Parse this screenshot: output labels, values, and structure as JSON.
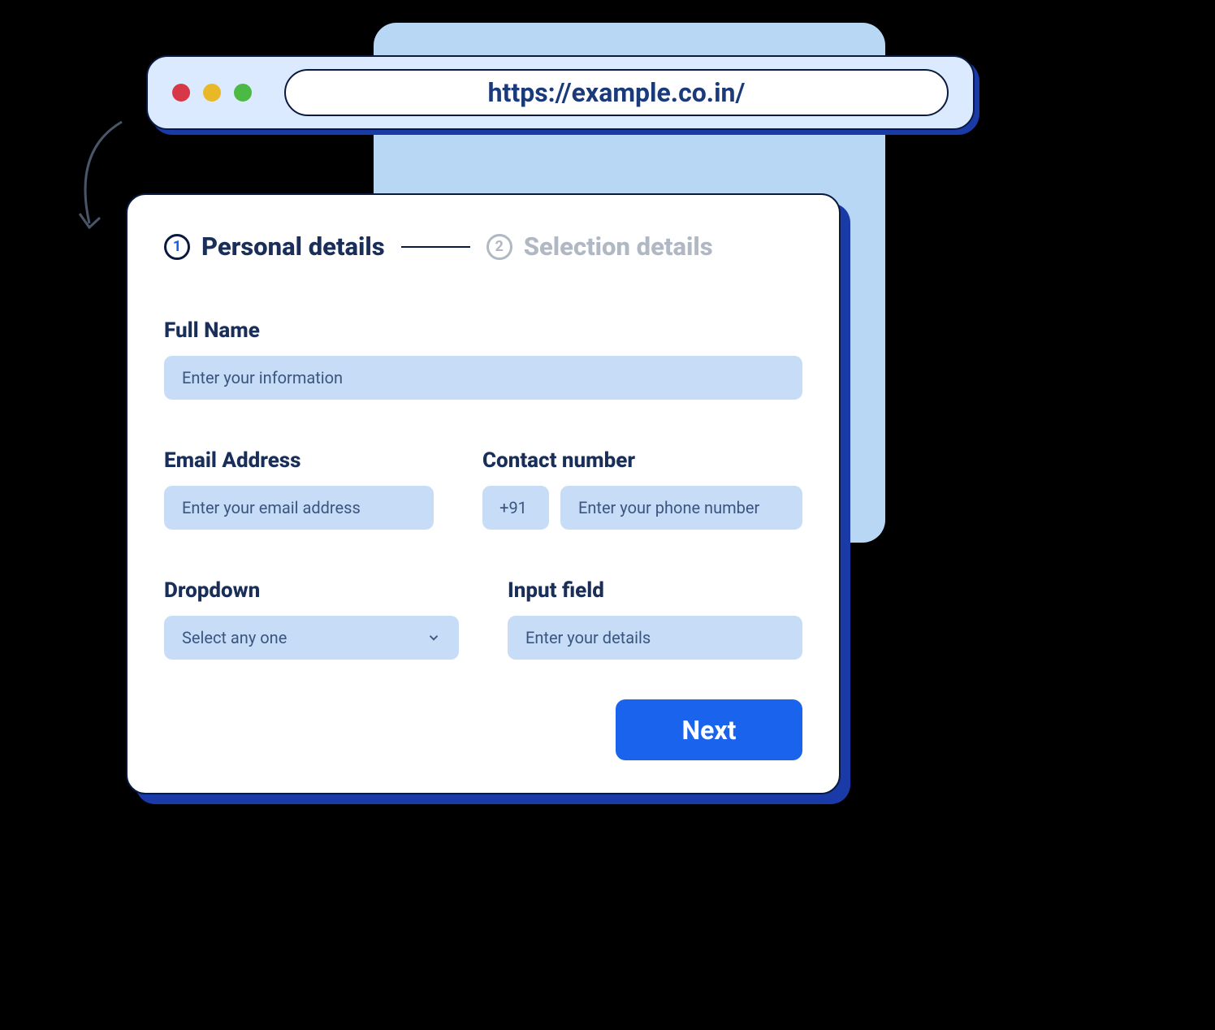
{
  "browser": {
    "url": "https://example.co.in/"
  },
  "stepper": {
    "step1": {
      "number": "1",
      "label": "Personal details"
    },
    "step2": {
      "number": "2",
      "label": "Selection details"
    }
  },
  "form": {
    "fullName": {
      "label": "Full Name",
      "placeholder": "Enter your information"
    },
    "email": {
      "label": "Email Address",
      "placeholder": "Enter your email address"
    },
    "contact": {
      "label": "Contact number",
      "countryCode": "+91",
      "placeholder": "Enter your phone number"
    },
    "dropdown": {
      "label": "Dropdown",
      "placeholder": "Select any one"
    },
    "inputField": {
      "label": "Input field",
      "placeholder": "Enter your details"
    }
  },
  "actions": {
    "next": "Next"
  }
}
